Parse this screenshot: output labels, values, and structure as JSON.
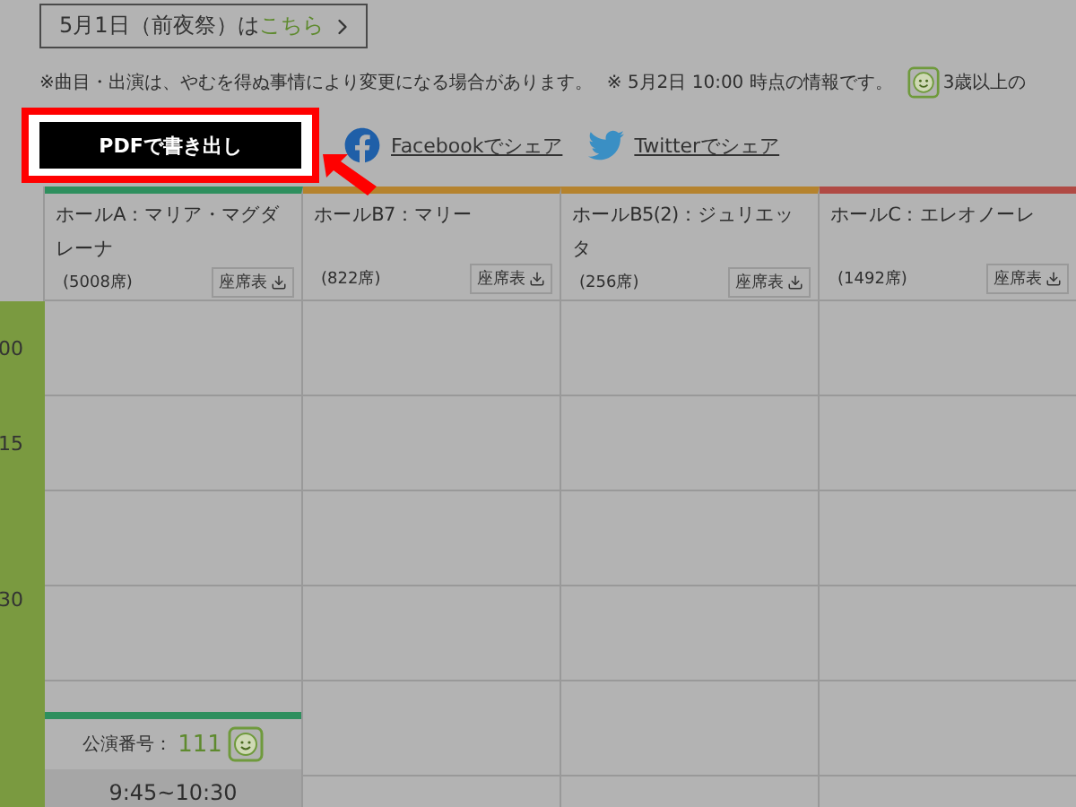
{
  "eve_link": {
    "text": "5月1日（前夜祭）は",
    "link": "こちら"
  },
  "notes": [
    {
      "kind": "text",
      "text": "※曲目・出演は、やむを得ぬ事情により変更になる場合があります。"
    },
    {
      "kind": "text",
      "text": "※ 5月2日 10:00 時点の情報です。"
    },
    {
      "kind": "child",
      "text": "3歳以上の"
    }
  ],
  "pdf_button": {
    "label": "PDFで書き出し",
    "highlighted": true
  },
  "share_links": [
    {
      "kind": "facebook",
      "label": "Facebookでシェア"
    },
    {
      "kind": "twitter",
      "label": "Twitterでシェア"
    }
  ],
  "halls": [
    {
      "name": "ホールA：マリア・マグダレーナ",
      "seats": "(5008席)",
      "seat_map": "座席表",
      "color": "#2e8f5e",
      "events": [
        {
          "number_label": "公演番号：",
          "number": "111",
          "child_ok": true,
          "time": "9:45~10:30",
          "color": "#2e8f5e"
        }
      ]
    },
    {
      "name": "ホールB7：マリー",
      "seats": "(822席)",
      "seat_map": "座席表",
      "color": "#b5832e"
    },
    {
      "name": "ホールB5(2)：ジュリエッタ",
      "seats": "(256席)",
      "seat_map": "座席表",
      "color": "#b5832e"
    },
    {
      "name": "ホールC：エレオノーレ",
      "seats": "(1492席)",
      "seat_map": "座席表",
      "color": "#b04a44"
    }
  ],
  "times": [
    "00",
    "15",
    "30"
  ]
}
